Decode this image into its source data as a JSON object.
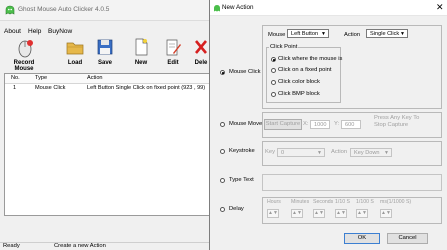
{
  "app": {
    "title": "Ghost Mouse Auto Clicker 4.0.5",
    "menu": [
      "About",
      "Help",
      "BuyNow"
    ],
    "toolbar": [
      {
        "label": "Record Mouse",
        "icon": "record-mouse-icon"
      },
      {
        "label": "Load",
        "icon": "folder-icon"
      },
      {
        "label": "Save",
        "icon": "floppy-disk-icon"
      },
      {
        "label": "New",
        "icon": "new-document-icon"
      },
      {
        "label": "Edit",
        "icon": "edit-icon"
      },
      {
        "label": "Dele",
        "icon": "delete-icon"
      }
    ],
    "list": {
      "headers": [
        "No.",
        "Type",
        "Action"
      ],
      "rows": [
        {
          "no": "1",
          "type": "Mouse Click",
          "action": "Left Button Single Click on fixed point (923 , 99)"
        }
      ]
    },
    "status": {
      "left": "Ready",
      "right": "Create a new Action"
    }
  },
  "dialog": {
    "title": "New Action",
    "mouse_click": {
      "label": "Mouse Click",
      "mouse_label": "Mouse",
      "mouse_value": "Left Button",
      "action_label": "Action",
      "action_value": "Single Click",
      "click_point_label": "Click Point",
      "options": [
        "Click where the mouse is",
        "Click on a fixed point",
        "Click color block",
        "Click BMP block"
      ],
      "selected_option": 0
    },
    "mouse_move": {
      "label": "Mouse Move",
      "start_capture": "Start Capture",
      "x_label": "X:",
      "x_value": "1000",
      "y_label": "Y:",
      "y_value": "600",
      "hint": "Press Any Key To Stop Capture"
    },
    "keystroke": {
      "label": "Keystroke",
      "key_label": "Key",
      "key_value": "0",
      "action_label": "Action",
      "action_value": "Key Down"
    },
    "type_text": {
      "label": "Type Text",
      "value": ""
    },
    "delay": {
      "label": "Delay",
      "fields": [
        "Hours",
        "Minutes",
        "Seconds",
        "1/10 S",
        "1/100 S",
        "ms(1/1000 S)"
      ]
    },
    "ok": "OK",
    "cancel": "Cancel",
    "selected_action": "mouse_click"
  }
}
